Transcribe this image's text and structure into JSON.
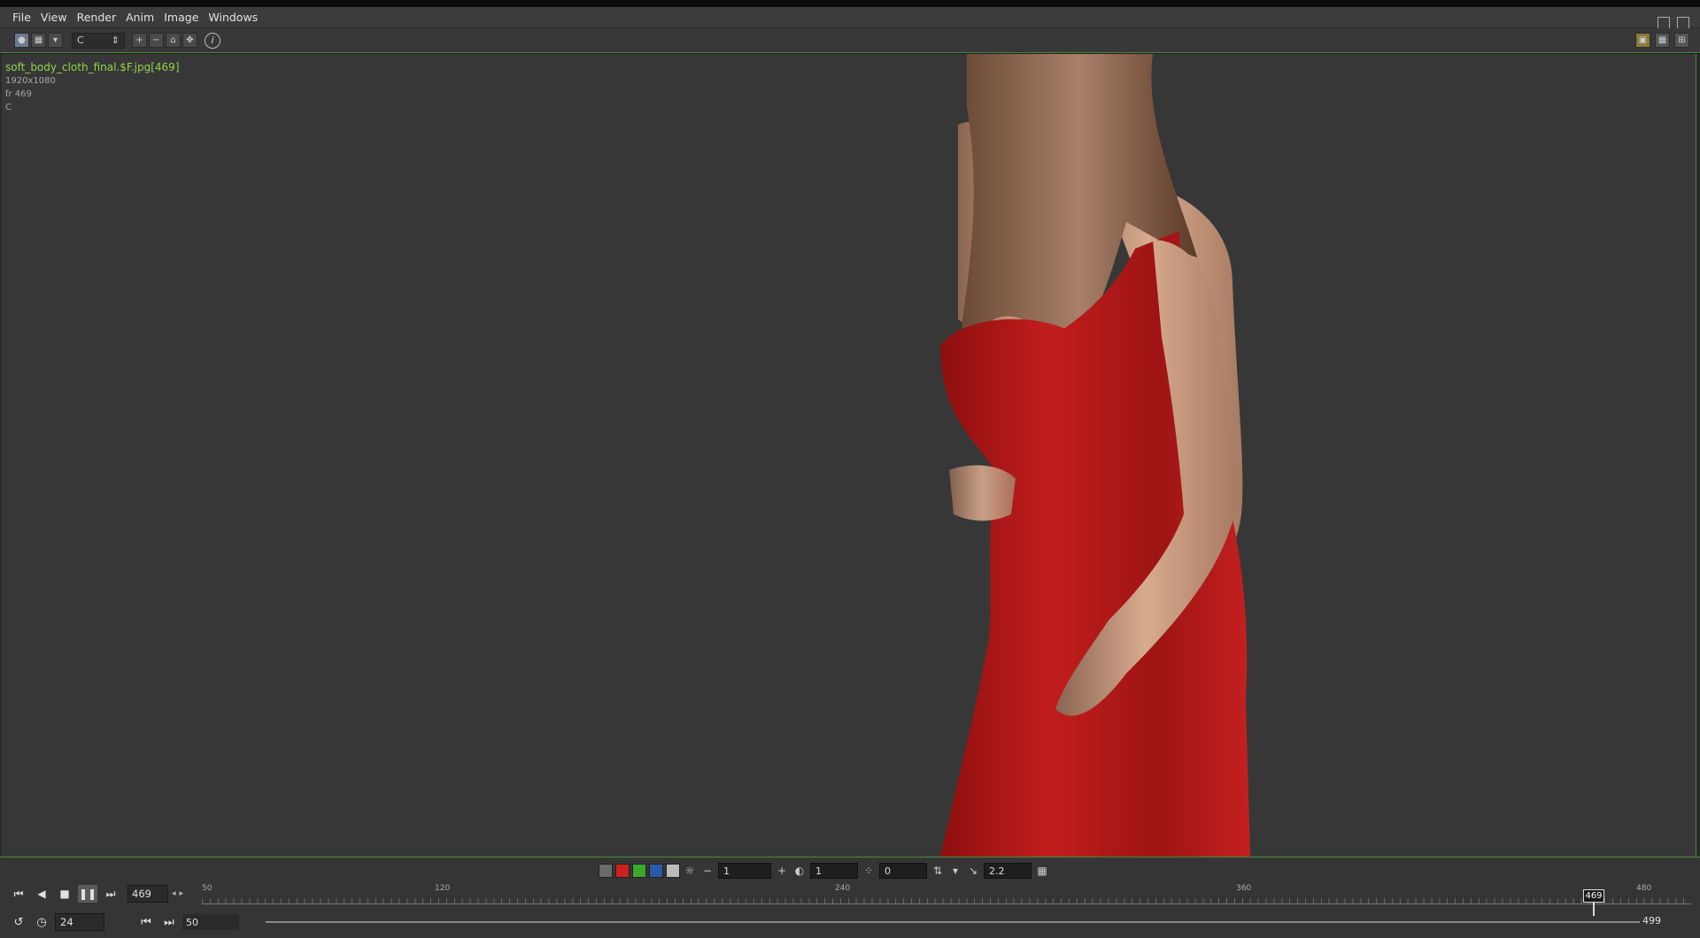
{
  "menubar": {
    "items": [
      "File",
      "View",
      "Render",
      "Anim",
      "Image",
      "Windows"
    ]
  },
  "toolbar": {
    "channel_value": "C",
    "channel_arrow": "⇕",
    "info_label": "i"
  },
  "viewport": {
    "image_title": "soft_body_cloth_final.$F.jpg[469]",
    "resolution": "1920x1080",
    "frame_info": "fr 469",
    "channel_info": "C"
  },
  "color_tools": {
    "exposure_value": "1",
    "gamma_left_value": "1",
    "offset_value": "0",
    "gamma_value": "2.2",
    "minus_label": "−",
    "plus_label": "+"
  },
  "playbar": {
    "current_frame": "469",
    "fps": "24",
    "range_start": "50",
    "range_end": "499"
  },
  "timeline": {
    "tick_labels": [
      "50",
      "120",
      "240",
      "360",
      "480"
    ],
    "cursor_label": "469"
  },
  "icons": {
    "first": "⏮",
    "back": "◀",
    "stop": "■",
    "pause": "❚❚",
    "last": "⏭",
    "prev": "◂",
    "next": "▸",
    "loop": "↺",
    "clock": "◷",
    "range_first": "⏮",
    "range_last": "⏭"
  },
  "colors": {
    "accent_green": "#8fd44a",
    "viewport_bg": "#373737",
    "dress_red": "#b01a1a"
  }
}
